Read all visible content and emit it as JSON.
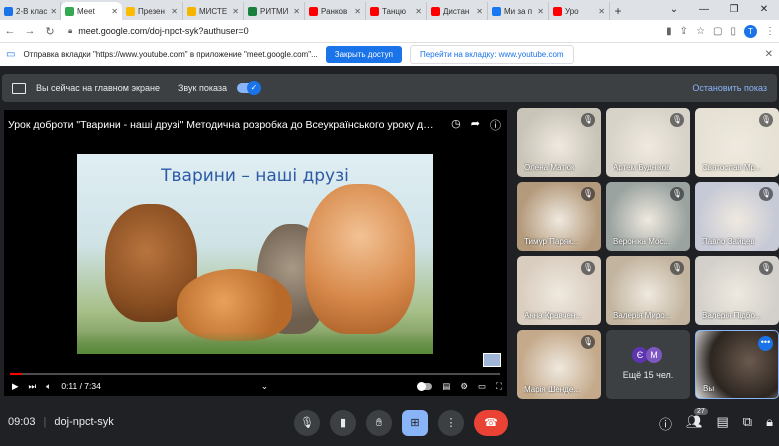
{
  "browser": {
    "tabs": [
      {
        "label": "2-В клас",
        "color": "#1a73e8"
      },
      {
        "label": "Meet",
        "color": "#34a853"
      },
      {
        "label": "Презен",
        "color": "#fbbc04"
      },
      {
        "label": "МИСТЕ",
        "color": "#f4b400"
      },
      {
        "label": "РИТМИ",
        "color": "#188038"
      },
      {
        "label": "Ранков",
        "color": "#ff0000"
      },
      {
        "label": "Танцю",
        "color": "#ff0000"
      },
      {
        "label": "Дистан",
        "color": "#ff0000"
      },
      {
        "label": "Ми за п",
        "color": "#1877f2"
      },
      {
        "label": "Уро",
        "color": "#ff0000"
      }
    ],
    "url": "meet.google.com/doj-npct-syk?authuser=0",
    "profile_initial": "T"
  },
  "infobar": {
    "message": "Отправка вкладки \"https://www.youtube.com\" в приложение \"meet.google.com\"...",
    "share_button": "Закрыть доступ",
    "switch_button": "Перейти на вкладку: www.youtube.com"
  },
  "presenting": {
    "status": "Вы сейчас на главном экране",
    "sound_label": "Звук показа",
    "stop_label": "Остановить показ"
  },
  "video": {
    "title": "Урок доброти \"Тварини - наші друзі\" Методична розробка до Всеукраїнського уроку доброт...",
    "frame_title": "Тварини – наші друзі",
    "time": "0:11 / 7:34",
    "progress": 0.024
  },
  "participants": [
    {
      "name": "Олена Матюк",
      "muted": true,
      "bg": "#c9c4b8"
    },
    {
      "name": "Артем Будніков",
      "muted": true,
      "bg": "#d8d3c8"
    },
    {
      "name": "Святослав Мр...",
      "muted": true,
      "bg": "#e6e1d4"
    },
    {
      "name": "Тимур Паряк...",
      "muted": true,
      "bg": "#b49a7c"
    },
    {
      "name": "Вероніка Мос...",
      "muted": true,
      "bg": "#9aa3a0"
    },
    {
      "name": "Павло Зайцев",
      "muted": true,
      "bg": "#c6c9d6"
    },
    {
      "name": "Анна Кравчен...",
      "muted": true,
      "bg": "#d9cdbf"
    },
    {
      "name": "Валерія Миро...",
      "muted": true,
      "bg": "#c2b49f"
    },
    {
      "name": "Валерія Підбо...",
      "muted": true,
      "bg": "#d3d0cb"
    },
    {
      "name": "Марія Шенде...",
      "muted": true,
      "bg": "#c4a98a"
    }
  ],
  "more": {
    "chip1": "Є",
    "chip2": "М",
    "label": "Ещё 15 чел."
  },
  "self": {
    "name": "Вы"
  },
  "bottom": {
    "time": "09:03",
    "code": "doj-npct-syk",
    "people_count": "27"
  }
}
